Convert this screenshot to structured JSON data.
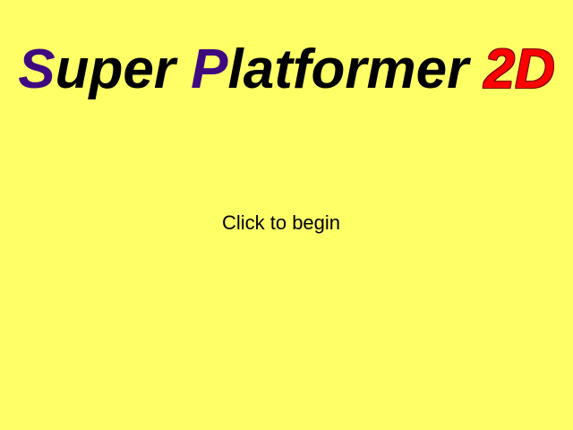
{
  "game": {
    "title": {
      "word1_initial": "S",
      "word1_rest": "uper ",
      "word2_initial": "P",
      "word2_rest": "latformer ",
      "suffix": "2D"
    },
    "prompt": "Click to begin"
  },
  "colors": {
    "background": "#ffff66",
    "title_initials": "#3f0a80",
    "title_text": "#000000",
    "title_suffix": "#ff0000",
    "prompt_text": "#000000"
  }
}
